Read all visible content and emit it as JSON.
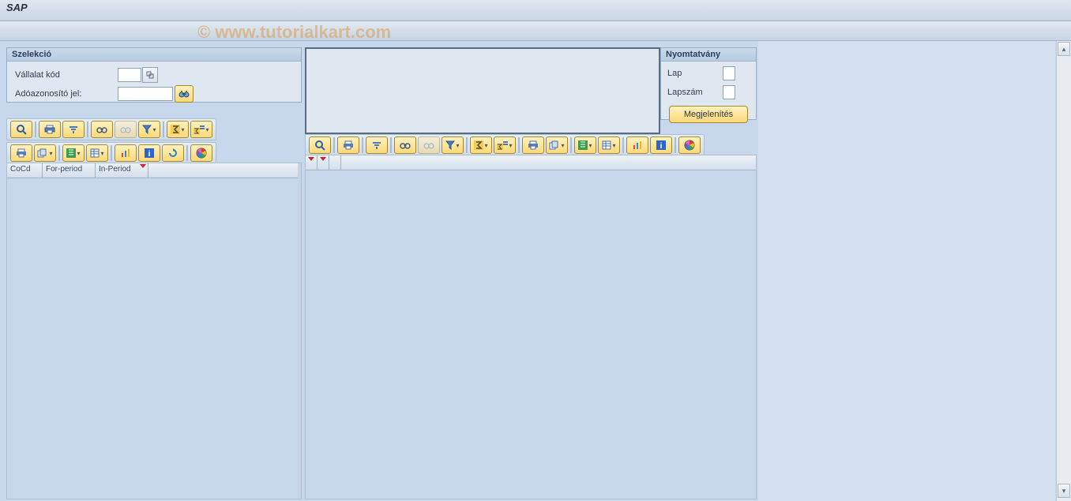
{
  "title": "SAP",
  "watermark": "© www.tutorialkart.com",
  "selection": {
    "header": "Szelekció",
    "company_code_label": "Vállalat kód",
    "tax_id_label": "Adóazonosító jel:"
  },
  "form": {
    "header": "Nyomtatvány",
    "sheet_label": "Lap",
    "page_count_label": "Lapszám",
    "display_button": "Megjelenítés"
  },
  "grid_left": {
    "columns": [
      "CoCd",
      "For-period",
      "In-Period"
    ]
  },
  "icons": {
    "details": "details",
    "print": "print",
    "filter": "filter",
    "find": "find",
    "find_next": "find-next",
    "set_filter": "set-filter",
    "sum": "sum",
    "subtotal": "subtotal",
    "export": "export",
    "send": "send",
    "local_file": "local-file",
    "layout": "layout",
    "graphic": "graphic",
    "info": "info",
    "refresh": "refresh",
    "abc": "abc"
  }
}
